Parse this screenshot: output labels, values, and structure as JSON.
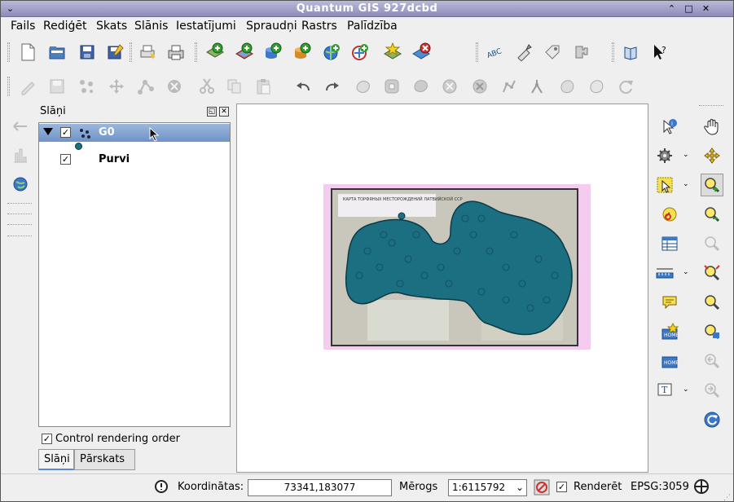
{
  "window": {
    "title": "Quantum GIS 927dcbd",
    "menu_glyph": "⌄",
    "minimize_glyph": "⌃",
    "restore_glyph": "□",
    "close_glyph": "✕"
  },
  "menu": [
    {
      "label": "Fails"
    },
    {
      "label": "Rediģēt"
    },
    {
      "label": "Skats"
    },
    {
      "label": "Slānis"
    },
    {
      "label": "Iestatījumi"
    },
    {
      "label": "Spraudņi"
    },
    {
      "label": "Rastrs"
    },
    {
      "label": "Palīdzība"
    }
  ],
  "layers_panel": {
    "title": "Slāņi",
    "layers": [
      {
        "name": "G0",
        "checked": true,
        "selected": true
      },
      {
        "name": "Purvi",
        "checked": true,
        "selected": false
      }
    ],
    "control_rendering_order": "Control rendering order",
    "tabs": [
      "Slāņi",
      "Pārskats"
    ]
  },
  "map": {
    "raster_title": "КАРТА ТОРФЯНЫХ МЕСТОРОЖДЕНИЙ ЛАТВИЙСКОЙ ССР",
    "point_color": "#1b6f80",
    "raster_bg": "#f4ccf0"
  },
  "status": {
    "coords_label": "Koordinātas:",
    "coords_value": "73341,183077",
    "scale_label": "Mērogs",
    "scale_value": "1:6115792",
    "render_label": "Renderēt",
    "render_checked": true,
    "crs": "EPSG:3059"
  },
  "icons": {
    "new": "new-project-icon",
    "open": "open-project-icon",
    "save": "save-icon",
    "zoom_in": "zoom-in-icon",
    "pan": "pan-icon"
  },
  "colors": {
    "titlebar": "#9f9fc8",
    "selection": "#7d9fd0"
  }
}
